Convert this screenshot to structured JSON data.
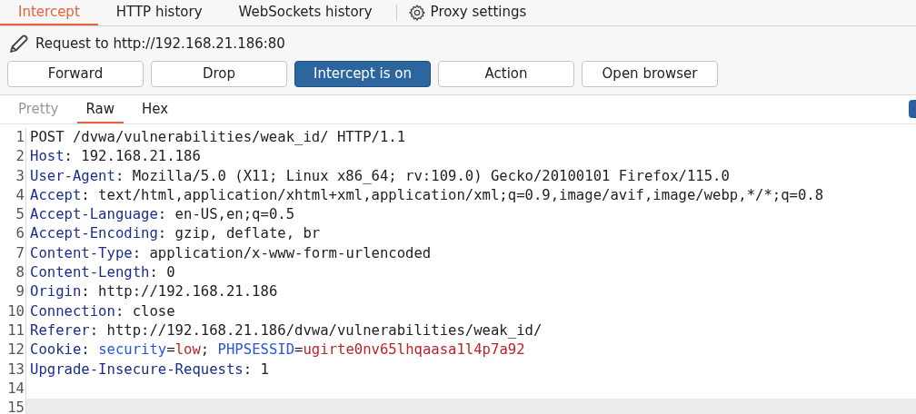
{
  "proxy_tabs": [
    {
      "label": "Intercept",
      "selected": true
    },
    {
      "label": "HTTP history",
      "selected": false
    },
    {
      "label": "WebSockets history",
      "selected": false
    }
  ],
  "settings_button": {
    "label": "Proxy settings"
  },
  "request_title": "Request to http://192.168.21.186:80",
  "buttons": [
    {
      "label": "Forward",
      "on": false
    },
    {
      "label": "Drop",
      "on": false
    },
    {
      "label": "Intercept is on",
      "on": true
    },
    {
      "label": "Action",
      "on": false
    },
    {
      "label": "Open browser",
      "on": false
    }
  ],
  "editor_tabs": [
    {
      "label": "Pretty",
      "selected": false,
      "disabled": true
    },
    {
      "label": "Raw",
      "selected": true,
      "disabled": false
    },
    {
      "label": "Hex",
      "selected": false,
      "disabled": false
    }
  ],
  "lines": [
    {
      "number": "1",
      "current": false,
      "segments": [
        {
          "kind": "plain",
          "text": "POST /dvwa/vulnerabilities/weak_id/ HTTP/1.1"
        }
      ]
    },
    {
      "number": "2",
      "current": false,
      "segments": [
        {
          "kind": "header",
          "text": "Host"
        },
        {
          "kind": "plain",
          "text": ": 192.168.21.186"
        }
      ]
    },
    {
      "number": "3",
      "current": false,
      "segments": [
        {
          "kind": "header",
          "text": "User-Agent"
        },
        {
          "kind": "plain",
          "text": ": Mozilla/5.0 (X11; Linux x86_64; rv:109.0) Gecko/20100101 Firefox/115.0"
        }
      ]
    },
    {
      "number": "4",
      "current": false,
      "segments": [
        {
          "kind": "header",
          "text": "Accept"
        },
        {
          "kind": "plain",
          "text": ": text/html,application/xhtml+xml,application/xml;q=0.9,image/avif,image/webp,*/*;q=0.8"
        }
      ]
    },
    {
      "number": "5",
      "current": false,
      "segments": [
        {
          "kind": "header",
          "text": "Accept-Language"
        },
        {
          "kind": "plain",
          "text": ": en-US,en;q=0.5"
        }
      ]
    },
    {
      "number": "6",
      "current": false,
      "segments": [
        {
          "kind": "header",
          "text": "Accept-Encoding"
        },
        {
          "kind": "plain",
          "text": ": gzip, deflate, br"
        }
      ]
    },
    {
      "number": "7",
      "current": false,
      "segments": [
        {
          "kind": "header",
          "text": "Content-Type"
        },
        {
          "kind": "plain",
          "text": ": application/x-www-form-urlencoded"
        }
      ]
    },
    {
      "number": "8",
      "current": false,
      "segments": [
        {
          "kind": "header",
          "text": "Content-Length"
        },
        {
          "kind": "plain",
          "text": ": 0"
        }
      ]
    },
    {
      "number": "9",
      "current": false,
      "segments": [
        {
          "kind": "header",
          "text": "Origin"
        },
        {
          "kind": "plain",
          "text": ": http://192.168.21.186"
        }
      ]
    },
    {
      "number": "10",
      "current": false,
      "segments": [
        {
          "kind": "header",
          "text": "Connection"
        },
        {
          "kind": "plain",
          "text": ": close"
        }
      ]
    },
    {
      "number": "11",
      "current": false,
      "segments": [
        {
          "kind": "header",
          "text": "Referer"
        },
        {
          "kind": "plain",
          "text": ": http://192.168.21.186/dvwa/vulnerabilities/weak_id/"
        }
      ]
    },
    {
      "number": "12",
      "current": false,
      "segments": [
        {
          "kind": "header",
          "text": "Cookie"
        },
        {
          "kind": "plain",
          "text": ": "
        },
        {
          "kind": "param_name",
          "text": "security"
        },
        {
          "kind": "plain",
          "text": "="
        },
        {
          "kind": "param_value",
          "text": "low"
        },
        {
          "kind": "plain",
          "text": "; "
        },
        {
          "kind": "param_name",
          "text": "PHPSESSID"
        },
        {
          "kind": "plain",
          "text": "="
        },
        {
          "kind": "param_value",
          "text": "ugirte0nv65lhqaasa1l4p7a92"
        }
      ]
    },
    {
      "number": "13",
      "current": false,
      "segments": [
        {
          "kind": "header",
          "text": "Upgrade-Insecure-Requests"
        },
        {
          "kind": "plain",
          "text": ": 1"
        }
      ]
    },
    {
      "number": "14",
      "current": false
    },
    {
      "number": "15",
      "current": true
    }
  ]
}
